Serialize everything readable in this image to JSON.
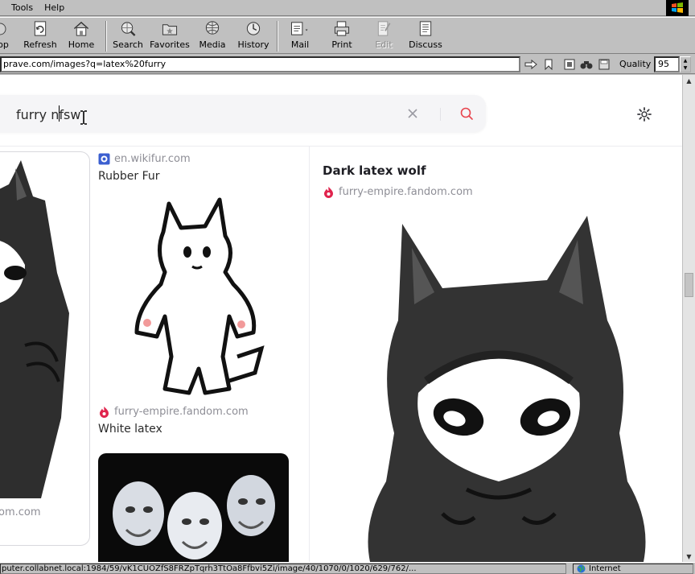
{
  "menu": {
    "tools": "Tools",
    "help": "Help"
  },
  "toolbar": {
    "stop": "op",
    "refresh": "Refresh",
    "home": "Home",
    "search": "Search",
    "favorites": "Favorites",
    "media": "Media",
    "history": "History",
    "mail": "Mail",
    "print": "Print",
    "edit": "Edit",
    "discuss": "Discuss"
  },
  "address": {
    "url": "prave.com/images?q=latex%20furry",
    "quality_label": "Quality",
    "quality_value": "95"
  },
  "search": {
    "query": "furry nfsw"
  },
  "results": {
    "left_card_domain": "om.com",
    "items": [
      {
        "source": "en.wikifur.com",
        "title": "Rubber Fur"
      },
      {
        "source": "furry-empire.fandom.com",
        "title": "White latex"
      }
    ]
  },
  "detail": {
    "title": "Dark latex wolf",
    "source": "furry-empire.fandom.com"
  },
  "status": {
    "text": "puter.collabnet.local:1984/59/vK1CUOZfS8FRZpTqrh3TtOa8Ffbvi5Zi/image/40/1070/0/1020/629/762/...",
    "zone": "Internet"
  },
  "colors": {
    "accent": "#e8444d",
    "fandom_flame": "#e0244d",
    "wikifur_blue": "#3b5fd0"
  }
}
